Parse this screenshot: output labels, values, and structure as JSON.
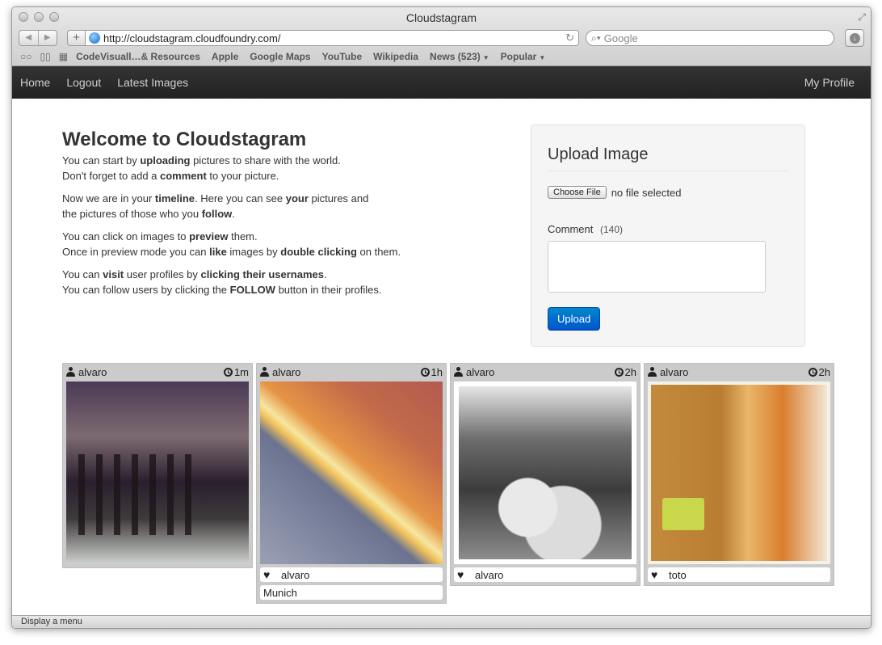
{
  "browser": {
    "window_title": "Cloudstagram",
    "url": "http://cloudstagram.cloudfoundry.com/",
    "search_placeholder": "Google",
    "bookmarks": [
      "CodeVisuall…& Resources",
      "Apple",
      "Google Maps",
      "YouTube",
      "Wikipedia",
      "News (523)",
      "Popular"
    ],
    "status_text": "Display a menu"
  },
  "navbar": {
    "items": [
      "Home",
      "Logout",
      "Latest Images"
    ],
    "right": "My Profile"
  },
  "welcome": {
    "title": "Welcome to Cloudstagram",
    "p1": {
      "a": "You can start by ",
      "b": "uploading",
      "c": " pictures to share with the world.",
      "d": "Don't forget to add a ",
      "e": "comment",
      "f": " to your picture."
    },
    "p2": {
      "a": "Now we are in your ",
      "b": "timeline",
      "c": ". Here you can see ",
      "d": "your",
      "e": " pictures and",
      "f": "the pictures of those who you ",
      "g": "follow",
      "h": "."
    },
    "p3": {
      "a": "You can click on images to ",
      "b": "preview",
      "c": " them.",
      "d": "Once in preview mode you can ",
      "e": "like",
      "f": " images by ",
      "g": "double clicking",
      "h": " on them."
    },
    "p4": {
      "a": "You can ",
      "b": "visit",
      "c": " user profiles by ",
      "d": "clicking their usernames",
      "e": ".",
      "f": "You can follow users by clicking the ",
      "g": "FOLLOW",
      "h": " button in their profiles."
    }
  },
  "upload": {
    "title": "Upload Image",
    "choose_file": "Choose File",
    "no_file": "no file selected",
    "comment_label": "Comment",
    "comment_count": "(140)",
    "button": "Upload"
  },
  "cards": [
    {
      "user": "alvaro",
      "time": "1m",
      "likes": null,
      "caption": null
    },
    {
      "user": "alvaro",
      "time": "1h",
      "likes": "alvaro",
      "caption": "Munich"
    },
    {
      "user": "alvaro",
      "time": "2h",
      "likes": "alvaro",
      "caption": null
    },
    {
      "user": "alvaro",
      "time": "2h",
      "likes": "toto",
      "caption": null
    }
  ],
  "colors": {
    "navbar_bg": "#222222",
    "upload_button": "#0077cc",
    "card_bg": "#cbcbcb"
  }
}
